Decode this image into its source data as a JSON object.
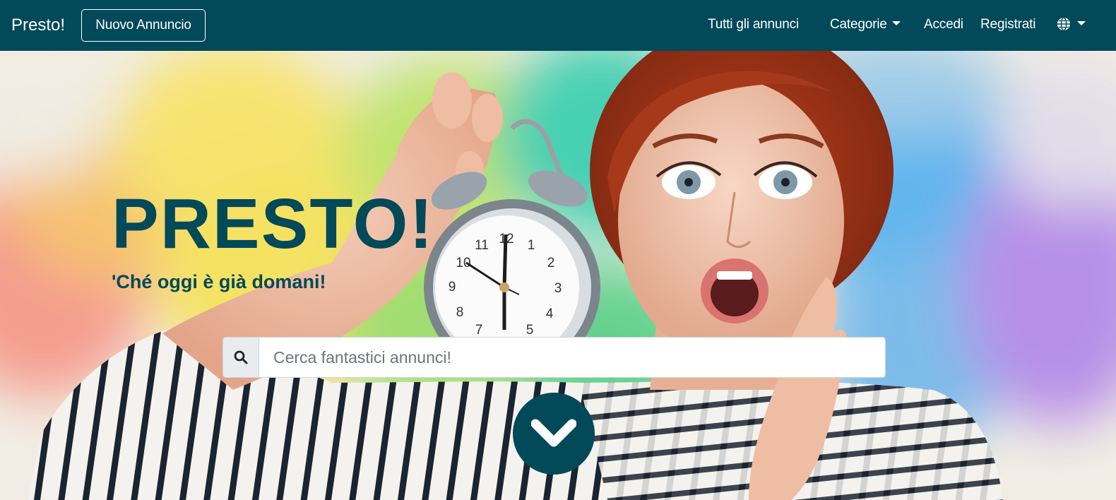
{
  "navbar": {
    "brand": "Presto!",
    "new_ad_label": "Nuovo Annuncio",
    "all_ads_label": "Tutti gli annunci",
    "categories_label": "Categorie",
    "login_label": "Accedi",
    "register_label": "Registrati",
    "language_icon": "globe-icon",
    "background_color": "#024959"
  },
  "hero": {
    "title": "PRESTO!",
    "subtitle": "'Ché oggi è già domani!",
    "accent_color": "#024959",
    "search": {
      "placeholder": "Cerca fantastici annunci!",
      "value": "",
      "icon": "search-icon"
    },
    "scroll_icon": "chevron-down-icon"
  }
}
